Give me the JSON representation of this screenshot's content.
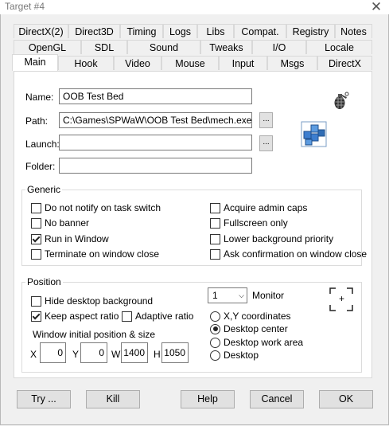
{
  "window": {
    "title": "Target #4",
    "close": "✕"
  },
  "tabs": {
    "row1": [
      "DirectX(2)",
      "Direct3D",
      "Timing",
      "Logs",
      "Libs",
      "Compat.",
      "Registry",
      "Notes"
    ],
    "row2": [
      "OpenGL",
      "SDL",
      "Sound",
      "Tweaks",
      "I/O",
      "Locale"
    ],
    "row3": [
      "Main",
      "Hook",
      "Video",
      "Mouse",
      "Input",
      "Msgs",
      "DirectX"
    ],
    "active": "Main"
  },
  "main": {
    "name_label": "Name:",
    "name_value": "OOB Test Bed",
    "path_label": "Path:",
    "path_value": "C:\\Games\\SPWaW\\OOB Test Bed\\mech.exe",
    "launch_label": "Launch:",
    "launch_value": "",
    "folder_label": "Folder:",
    "folder_value": "",
    "browse": "..."
  },
  "generic": {
    "title": "Generic",
    "left": [
      {
        "label": "Do not notify on task switch",
        "checked": false
      },
      {
        "label": "No banner",
        "checked": false
      },
      {
        "label": "Run in Window",
        "checked": true
      },
      {
        "label": "Terminate on window close",
        "checked": false
      }
    ],
    "right": [
      {
        "label": "Acquire admin caps",
        "checked": false
      },
      {
        "label": "Fullscreen only",
        "checked": false
      },
      {
        "label": "Lower background priority",
        "checked": false
      },
      {
        "label": "Ask confirmation on window close",
        "checked": false
      }
    ]
  },
  "position": {
    "title": "Position",
    "hide_desktop": {
      "label": "Hide desktop background",
      "checked": false
    },
    "keep_aspect": {
      "label": "Keep aspect ratio",
      "checked": true
    },
    "adaptive": {
      "label": "Adaptive ratio",
      "checked": false
    },
    "initial_label": "Window initial position & size",
    "x_label": "X",
    "x_value": "0",
    "y_label": "Y",
    "y_value": "0",
    "w_label": "W",
    "w_value": "1400",
    "h_label": "H",
    "h_value": "1050",
    "monitor_value": "1",
    "monitor_label": "Monitor",
    "radios": [
      {
        "label": "X,Y coordinates",
        "selected": false
      },
      {
        "label": "Desktop center",
        "selected": true
      },
      {
        "label": "Desktop work area",
        "selected": false
      },
      {
        "label": "Desktop",
        "selected": false
      }
    ],
    "crosshair": "+"
  },
  "buttons": {
    "try": "Try ...",
    "kill": "Kill",
    "help": "Help",
    "cancel": "Cancel",
    "ok": "OK"
  }
}
